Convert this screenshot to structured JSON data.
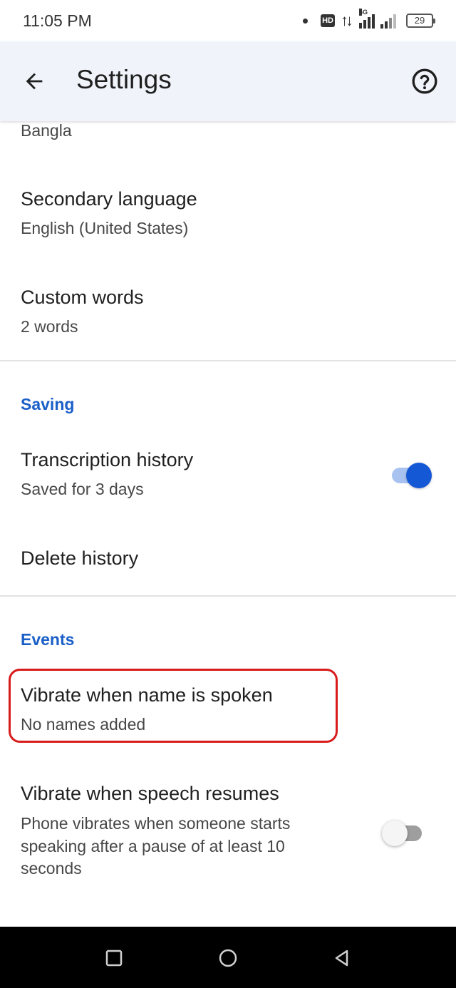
{
  "status_bar": {
    "time": "11:05 PM",
    "hd_label": "HD",
    "net_label": "4G",
    "battery": "29"
  },
  "app_bar": {
    "title": "Settings",
    "back_icon": "arrow-left-icon",
    "help_icon": "help-circle-icon"
  },
  "settings": {
    "primary_language_value": "Bangla",
    "secondary_language": {
      "title": "Secondary language",
      "value": "English (United States)"
    },
    "custom_words": {
      "title": "Custom words",
      "value": "2 words"
    },
    "saving_header": "Saving",
    "transcription_history": {
      "title": "Transcription history",
      "value": "Saved for 3 days",
      "enabled": true
    },
    "delete_history": {
      "title": "Delete history"
    },
    "events_header": "Events",
    "vibrate_name": {
      "title": "Vibrate when name is spoken",
      "value": "No names added"
    },
    "vibrate_speech": {
      "title": "Vibrate when speech resumes",
      "line1": "Phone vibrates when someone starts",
      "line2": "speaking after a pause of at least 10",
      "line3": "seconds",
      "enabled": false
    }
  },
  "colors": {
    "accent": "#1558d6",
    "section_header": "#1a5fc8",
    "highlight": "#d81b1b",
    "app_bar_bg": "#f0f4fa"
  },
  "nav_bar": {
    "recents_icon": "square-icon",
    "home_icon": "circle-icon",
    "back_icon": "triangle-back-icon"
  }
}
